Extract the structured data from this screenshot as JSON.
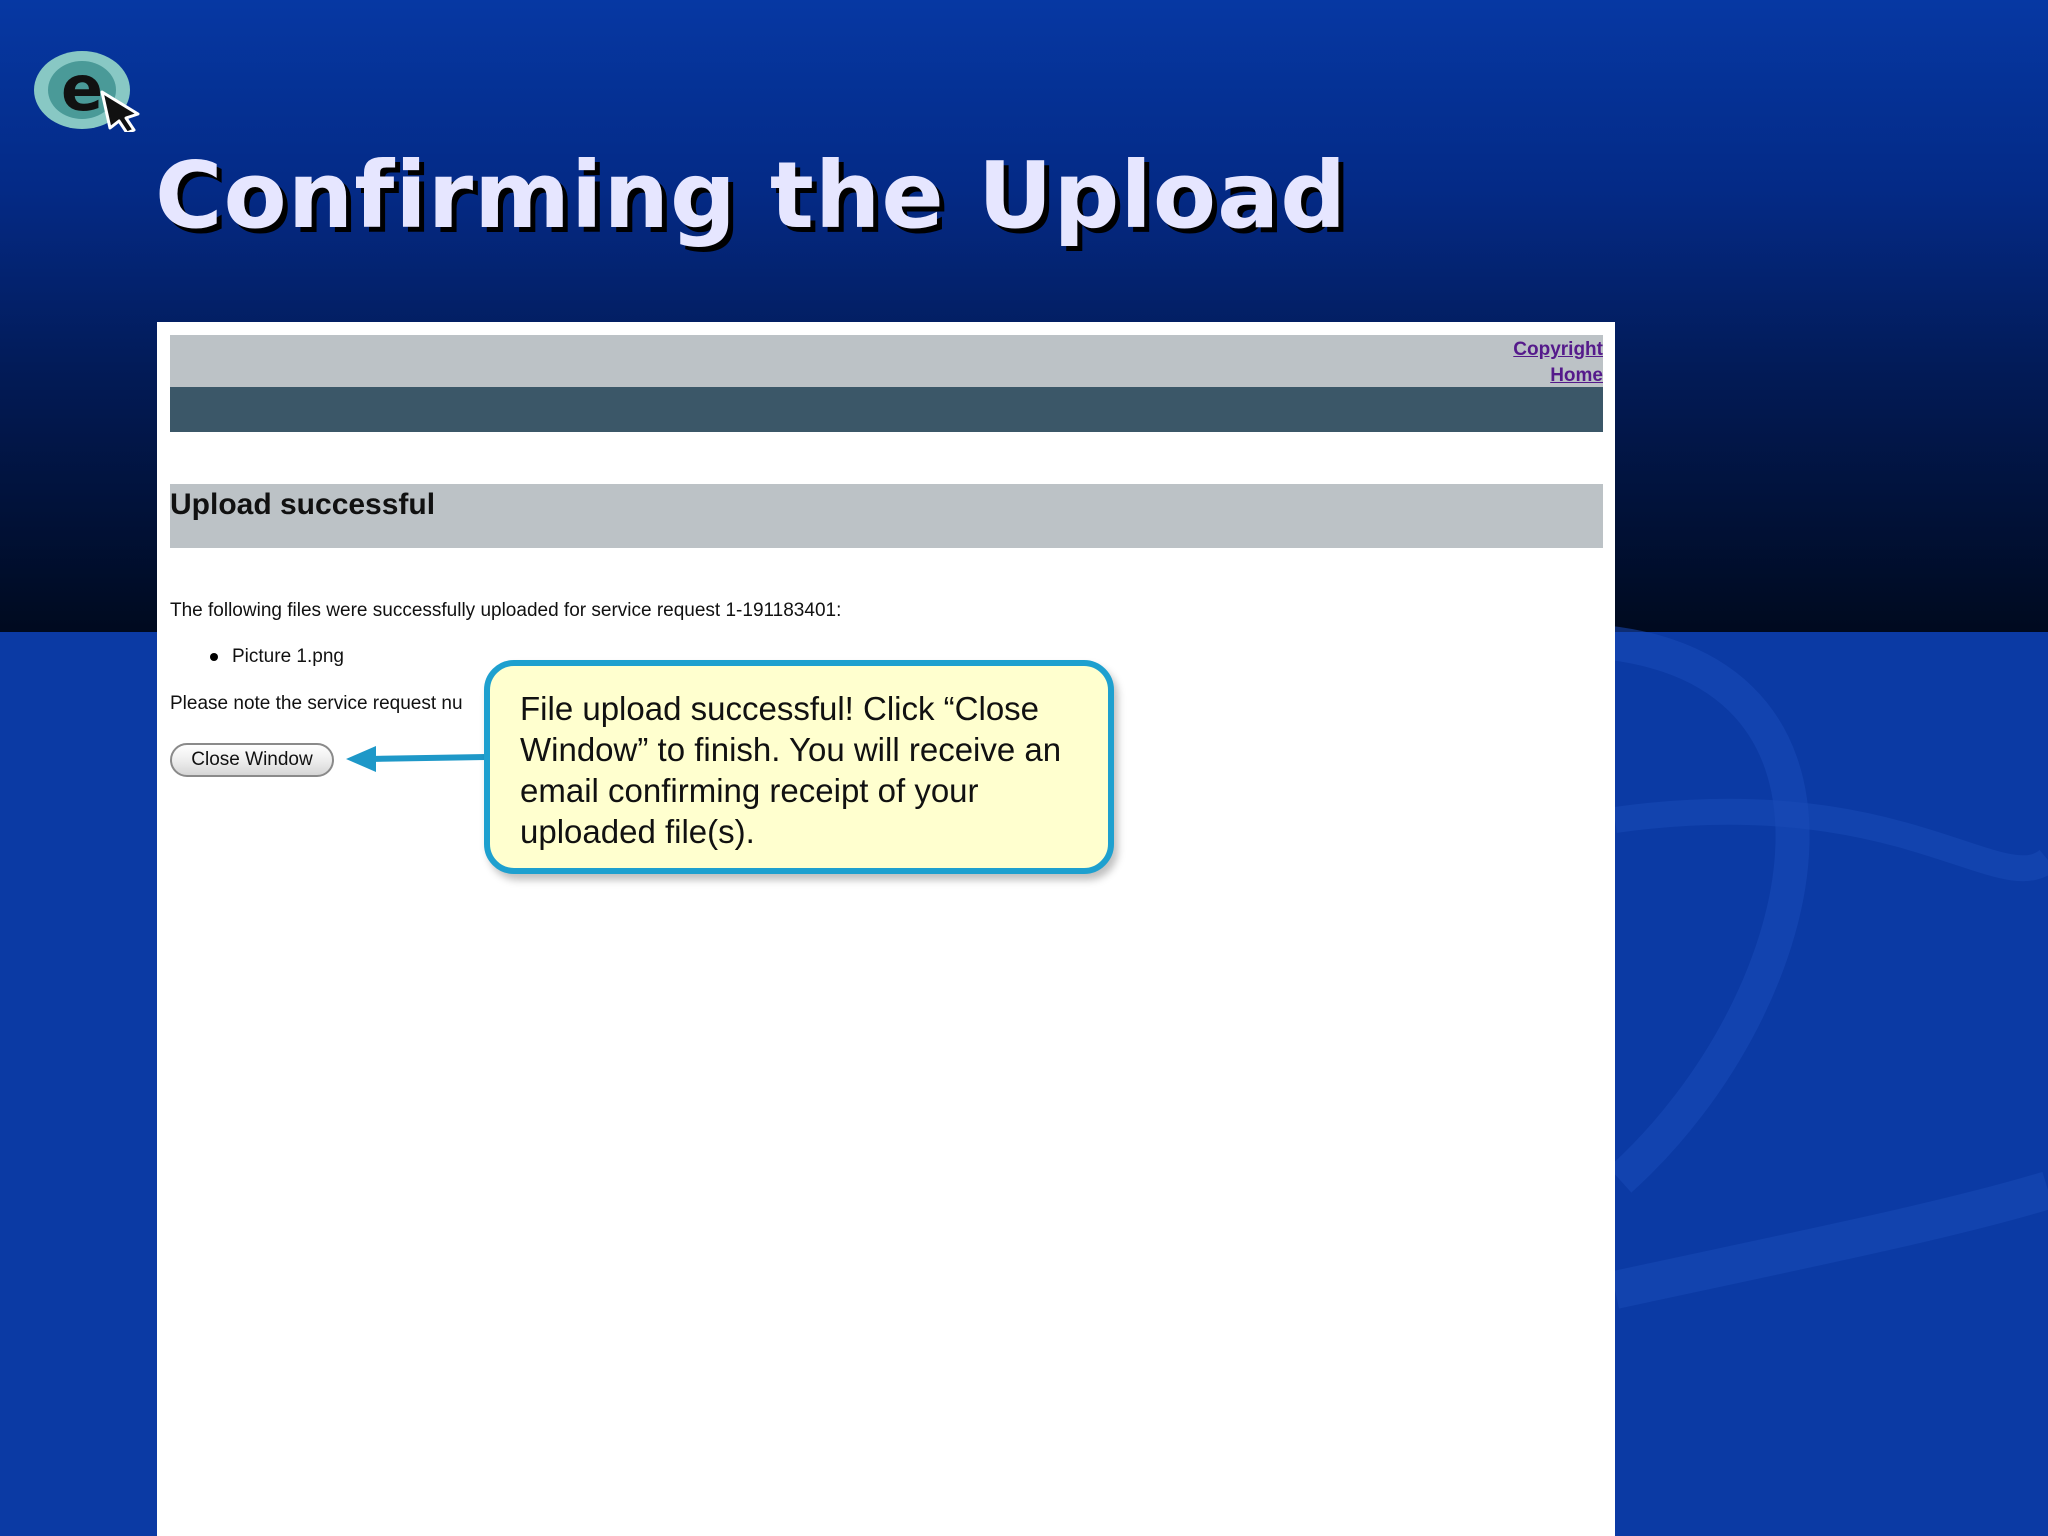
{
  "slide": {
    "title": "Confirming the Upload"
  },
  "screenshot": {
    "links": {
      "copyright": "Copyright",
      "home": "Home"
    },
    "heading": "Upload successful",
    "message": "The following files were successfully uploaded for service request 1-191183401:",
    "files": [
      "Picture 1.png"
    ],
    "note": "Please note the service request nu",
    "close_button": "Close Window"
  },
  "callout": {
    "text": "File upload successful! Click “Close Window” to finish. You will receive an email confirming receipt of your uploaded file(s)."
  },
  "colors": {
    "slide_background": "#0b3aa4",
    "title_text": "#e6e6ff",
    "header_gray": "#bcc2c6",
    "header_band": "#3b5768",
    "visited_link": "#551a8b",
    "callout_border": "#1ea0cf",
    "callout_fill": "#ffffcf"
  },
  "icons": {
    "logo": "e-cursor-logo",
    "pointer": "arrow-left-icon"
  }
}
